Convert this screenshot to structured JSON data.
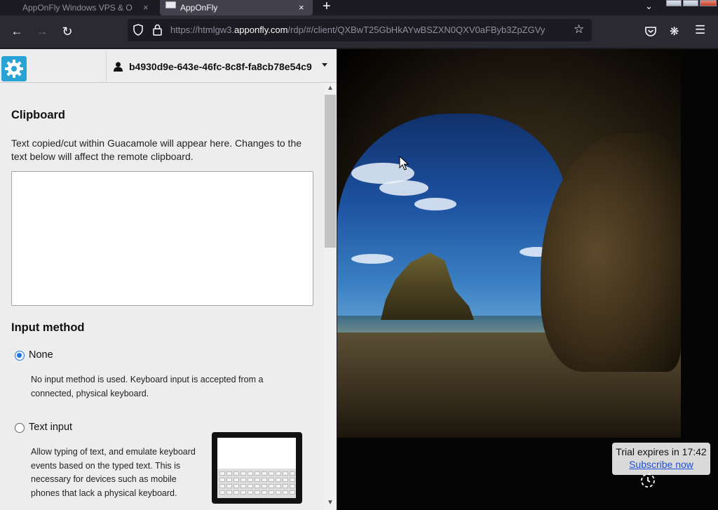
{
  "browser": {
    "tabs": [
      {
        "title": "AppOnFly Windows VPS & O",
        "active": false
      },
      {
        "title": "AppOnFly",
        "active": true
      }
    ],
    "close_glyph": "×",
    "new_tab_glyph": "+",
    "list_tabs_glyph": "⌄",
    "url_prefix": "https://htmlgw3.",
    "url_host": "apponfly.com",
    "url_path": "/rdp/#/client/QXBwT25GbHkAYwBSZXN0QXV0aFByb3ZpZGVy",
    "icons": [
      "back-arrow-icon",
      "forward-arrow-icon",
      "reload-icon",
      "shield-icon",
      "lock-icon",
      "star-icon",
      "pocket-icon",
      "extensions-icon",
      "menu-icon"
    ]
  },
  "sidebar": {
    "username": "b4930d9e-643e-46fc-8c8f-fa8cb78e54c9",
    "clipboard": {
      "title": "Clipboard",
      "description": "Text copied/cut within Guacamole will appear here. Changes to the text below will affect the remote clipboard.",
      "value": ""
    },
    "input_method": {
      "title": "Input method",
      "options": [
        {
          "label": "None",
          "selected": true,
          "description": "No input method is used. Keyboard input is accepted from a connected, physical keyboard."
        },
        {
          "label": "Text input",
          "selected": false,
          "description": "Allow typing of text, and emulate keyboard events based on the typed text. This is necessary for devices such as mobile phones that lack a physical keyboard."
        }
      ]
    }
  },
  "remote": {
    "trial_text": "Trial expires in 17:42",
    "subscribe_label": "Subscribe now"
  },
  "colors": {
    "accent": "#29a3d6",
    "radio": "#1a73e8",
    "link": "#1d4fd8"
  }
}
